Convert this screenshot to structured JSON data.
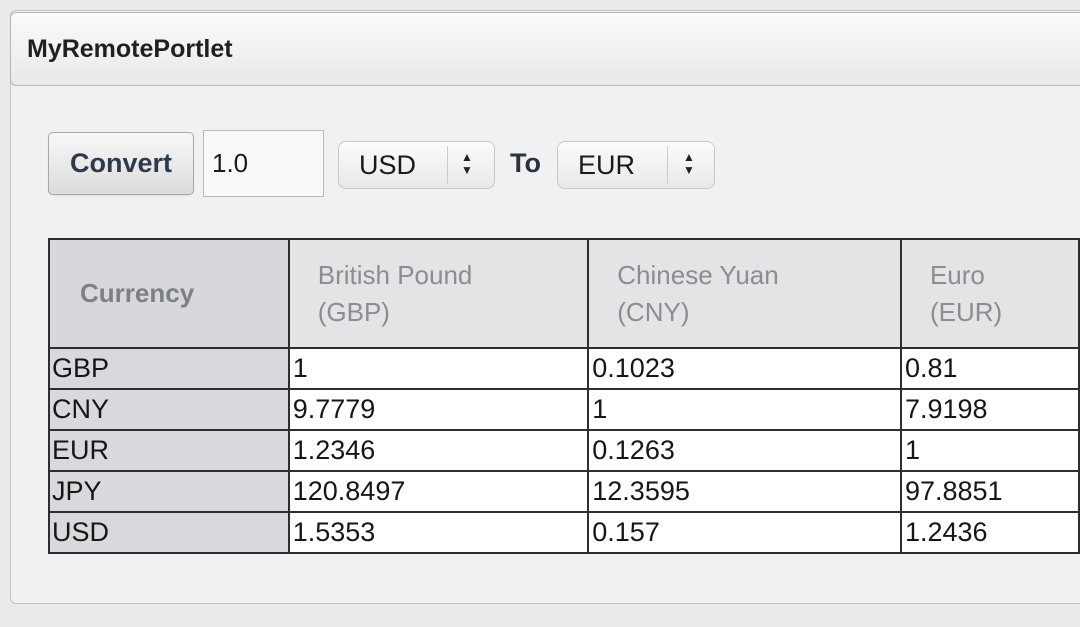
{
  "portlet": {
    "title": "MyRemotePortlet"
  },
  "form": {
    "convert_label": "Convert",
    "amount_value": "1.0",
    "from_currency": "USD",
    "to_label": "To",
    "to_currency": "EUR"
  },
  "table": {
    "corner_label": "Currency",
    "columns": [
      {
        "name": "British Pound",
        "code": "(GBP)"
      },
      {
        "name": "Chinese Yuan",
        "code": "(CNY)"
      },
      {
        "name": "Euro",
        "code": "(EUR)"
      }
    ],
    "rows": [
      {
        "label": "GBP",
        "cells": [
          "1",
          "0.1023",
          "0.81"
        ]
      },
      {
        "label": "CNY",
        "cells": [
          "9.7779",
          "1",
          "7.9198"
        ]
      },
      {
        "label": "EUR",
        "cells": [
          "1.2346",
          "0.1263",
          "1"
        ]
      },
      {
        "label": "JPY",
        "cells": [
          "120.8497",
          "12.3595",
          "97.8851"
        ]
      },
      {
        "label": "USD",
        "cells": [
          "1.5353",
          "0.157",
          "1.2436"
        ]
      }
    ]
  }
}
